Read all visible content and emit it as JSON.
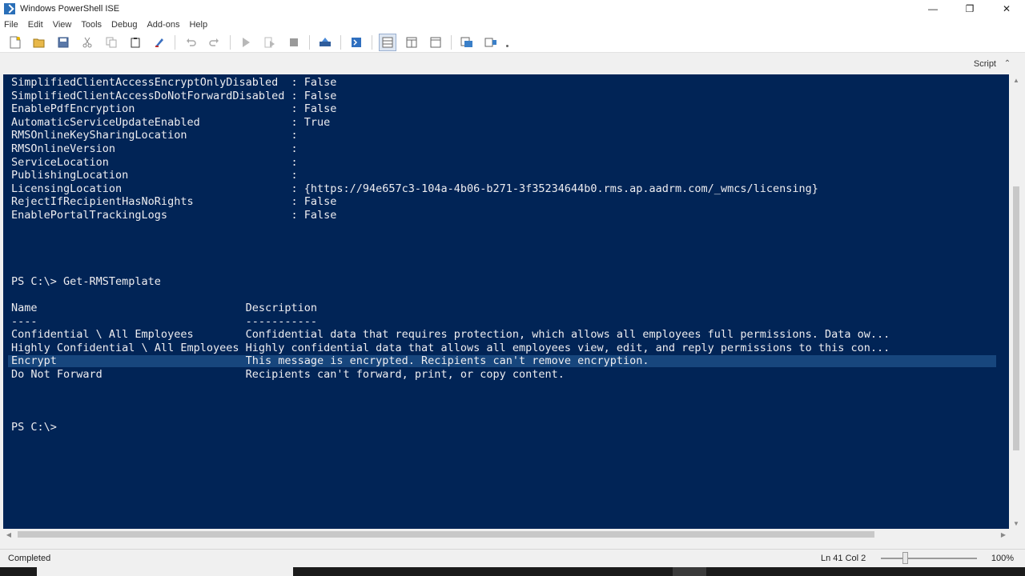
{
  "window": {
    "title": "Windows PowerShell ISE",
    "minimize": "—",
    "restore": "❐",
    "close": "✕"
  },
  "menu": [
    "File",
    "Edit",
    "View",
    "Tools",
    "Debug",
    "Add-ons",
    "Help"
  ],
  "toolbar": {
    "icons": [
      "new-icon",
      "open-icon",
      "save-icon",
      "cut-icon",
      "copy-icon",
      "paste-icon",
      "clear-console-icon",
      "undo-icon",
      "redo-icon",
      "run-icon",
      "run-selection-icon",
      "stop-icon",
      "remote-powershell-icon",
      "powershell-icon",
      "show-script-pane-top-icon",
      "show-script-pane-right-icon",
      "show-script-pane-max-icon",
      "show-command-window-icon",
      "show-command-addon-icon"
    ]
  },
  "script_tab": {
    "label": "Script"
  },
  "console": {
    "properties": [
      {
        "name": "SimplifiedClientAccessEncryptOnlyDisabled",
        "value": "False"
      },
      {
        "name": "SimplifiedClientAccessDoNotForwardDisabled",
        "value": "False"
      },
      {
        "name": "EnablePdfEncryption",
        "value": "False"
      },
      {
        "name": "AutomaticServiceUpdateEnabled",
        "value": "True"
      },
      {
        "name": "RMSOnlineKeySharingLocation",
        "value": ""
      },
      {
        "name": "RMSOnlineVersion",
        "value": ""
      },
      {
        "name": "ServiceLocation",
        "value": ""
      },
      {
        "name": "PublishingLocation",
        "value": ""
      },
      {
        "name": "LicensingLocation",
        "value": "{https://94e657c3-104a-4b06-b271-3f35234644b0.rms.ap.aadrm.com/_wmcs/licensing}"
      },
      {
        "name": "RejectIfRecipientHasNoRights",
        "value": "False"
      },
      {
        "name": "EnablePortalTrackingLogs",
        "value": "False"
      }
    ],
    "command_line": "PS C:\\> Get-RMSTemplate",
    "table_headers": {
      "name": "Name",
      "description": "Description"
    },
    "table_underlines": {
      "name": "----",
      "description": "-----------"
    },
    "templates": [
      {
        "name": "Confidential \\ All Employees",
        "description": "Confidential data that requires protection, which allows all employees full permissions. Data ow..."
      },
      {
        "name": "Highly Confidential \\ All Employees",
        "description": "Highly confidential data that allows all employees view, edit, and reply permissions to this con..."
      },
      {
        "name": "Encrypt",
        "description": "This message is encrypted. Recipients can't remove encryption."
      },
      {
        "name": "Do Not Forward",
        "description": "Recipients can't forward, print, or copy content."
      }
    ],
    "prompt": "PS C:\\>"
  },
  "status": {
    "text": "Completed",
    "position": "Ln 41  Col 2",
    "zoom": "100%",
    "zoom_level": 0.25
  }
}
